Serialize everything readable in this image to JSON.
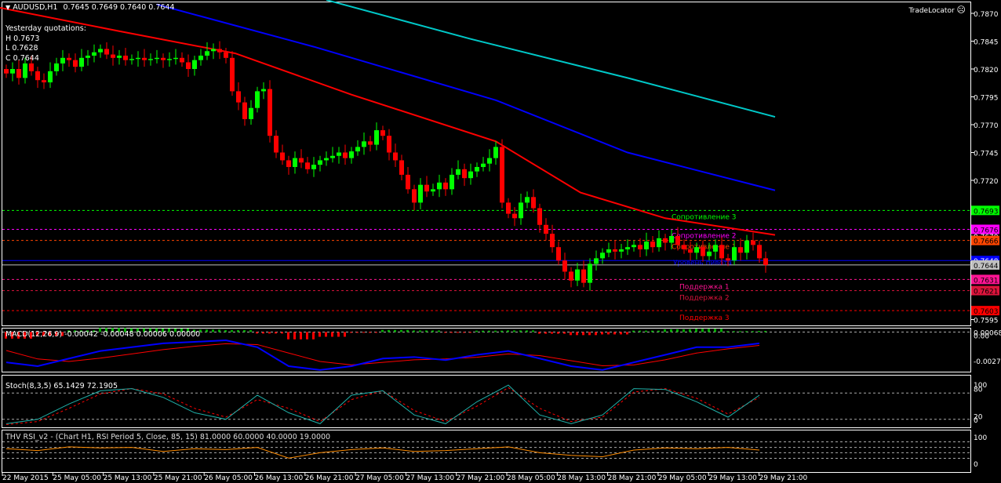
{
  "header": {
    "symbol": "AUDUSD,H1",
    "ohlc": "0.7645 0.7649 0.7640 0.7644"
  },
  "yesterday": {
    "title": "Yesterday quotations:",
    "h": "H 0.7673",
    "l": "L 0.7628",
    "c": "C 0.7644"
  },
  "tradelocator": "TradeLocator",
  "colors": {
    "bull": "#00ff00",
    "bear": "#ff0000",
    "axis": "#ffffff",
    "ma_fast": "#ff0000",
    "ma_mid": "#0000ff",
    "ma_slow": "#00c8c8"
  },
  "chart_data": {
    "type": "candlestick",
    "title": "AUDUSD,H1",
    "ylim": [
      0.759,
      0.7882
    ],
    "price_ticks": [
      "0.7870",
      "0.7845",
      "0.7820",
      "0.7795",
      "0.7770",
      "0.7745",
      "0.7720",
      "0.7670",
      "0.7595"
    ],
    "price_tick_values": [
      0.787,
      0.7845,
      0.782,
      0.7795,
      0.777,
      0.7745,
      0.772,
      0.767,
      0.7595
    ],
    "closes": [
      0.7816,
      0.782,
      0.7812,
      0.7825,
      0.7818,
      0.781,
      0.7808,
      0.7818,
      0.7825,
      0.783,
      0.7828,
      0.7822,
      0.783,
      0.7832,
      0.7835,
      0.7838,
      0.7833,
      0.783,
      0.7832,
      0.7828,
      0.7829,
      0.783,
      0.7828,
      0.7829,
      0.783,
      0.7828,
      0.7829,
      0.783,
      0.7826,
      0.782,
      0.7828,
      0.7832,
      0.7836,
      0.7838,
      0.7835,
      0.783,
      0.78,
      0.779,
      0.7775,
      0.7785,
      0.78,
      0.7802,
      0.776,
      0.7745,
      0.7738,
      0.7732,
      0.774,
      0.7736,
      0.773,
      0.7734,
      0.7738,
      0.774,
      0.7742,
      0.7745,
      0.774,
      0.7746,
      0.775,
      0.7755,
      0.7752,
      0.7765,
      0.776,
      0.7745,
      0.7738,
      0.7725,
      0.7712,
      0.77,
      0.7716,
      0.771,
      0.7712,
      0.7718,
      0.7712,
      0.7725,
      0.773,
      0.7722,
      0.7728,
      0.7732,
      0.7735,
      0.774,
      0.775,
      0.77,
      0.769,
      0.7686,
      0.77,
      0.7705,
      0.7695,
      0.768,
      0.7672,
      0.766,
      0.7648,
      0.7638,
      0.763,
      0.764,
      0.7628,
      0.7645,
      0.765,
      0.7655,
      0.7658,
      0.7656,
      0.7658,
      0.766,
      0.7662,
      0.7658,
      0.7665,
      0.766,
      0.7668,
      0.7664,
      0.767,
      0.7662,
      0.7658,
      0.7655,
      0.766,
      0.7652,
      0.7656,
      0.7662,
      0.765,
      0.7648,
      0.766,
      0.7655,
      0.7666,
      0.7662,
      0.765,
      0.7644
    ],
    "moving_averages": [
      {
        "name": "ma_slow",
        "color": "#00c8c8",
        "points": [
          [
            51,
            0.7882
          ],
          [
            74,
            0.7847
          ],
          [
            99,
            0.7812
          ],
          [
            122.5,
            0.7777
          ]
        ]
      },
      {
        "name": "ma_mid",
        "color": "#0000ff",
        "points": [
          [
            24,
            0.7878
          ],
          [
            49,
            0.784
          ],
          [
            78,
            0.7792
          ],
          [
            99,
            0.7745
          ],
          [
            122.5,
            0.7711
          ]
        ]
      },
      {
        "name": "ma_fast",
        "color": "#ff0000",
        "points": [
          [
            -1,
            0.7875
          ],
          [
            18,
            0.7854
          ],
          [
            36.5,
            0.7834
          ],
          [
            55,
            0.7797
          ],
          [
            78,
            0.7755
          ],
          [
            91.5,
            0.7709
          ],
          [
            105,
            0.7686
          ],
          [
            122.5,
            0.7671
          ]
        ]
      }
    ],
    "levels": [
      {
        "label": "Сопротивление 3",
        "value": 0.7693,
        "tag": "0.7693",
        "color": "#00ff00",
        "dash": true
      },
      {
        "label": "Сопротивление 2",
        "value": 0.7676,
        "tag": "0.7676",
        "color": "#ff00ff",
        "dash": true
      },
      {
        "label": "Сопротивление 1",
        "value": 0.7666,
        "tag": "0.7666",
        "color": "#ff4500",
        "dash": true
      },
      {
        "label": "Уровень пивота",
        "value": 0.7648,
        "tag": "0.7648",
        "color": "#0000ff",
        "dash": false
      },
      {
        "label": "",
        "value": 0.7644,
        "tag": "0.7644",
        "color": "#c0c0c0",
        "dash": false
      },
      {
        "label": "Поддержка 1",
        "value": 0.7631,
        "tag": "0.7631",
        "color": "#ff1493",
        "dash": true
      },
      {
        "label": "Поддержка 2",
        "value": 0.7621,
        "tag": "0.7621",
        "color": "#dc143c",
        "dash": true
      },
      {
        "label": "Поддержка 3",
        "value": 0.7603,
        "tag": "0.7603",
        "color": "#ff0000",
        "dash": true
      }
    ],
    "time_labels": [
      "22 May 2015",
      "25 May 05:00",
      "25 May 13:00",
      "25 May 21:00",
      "26 May 05:00",
      "26 May 13:00",
      "26 May 21:00",
      "27 May 05:00",
      "27 May 13:00",
      "27 May 21:00",
      "28 May 05:00",
      "28 May 13:00",
      "28 May 21:00",
      "29 May 05:00",
      "29 May 13:00",
      "29 May 21:00"
    ],
    "macd": {
      "label": "MACD(12,26,9) -0.00042 -0.00048 0.00006 0.00000",
      "ticks": [
        "0.00068",
        "0.00",
        "-0.00272"
      ],
      "ylim": [
        -0.004,
        0.001
      ],
      "sample_step": 5,
      "main": [
        -0.0029,
        -0.00335,
        -0.00245,
        -0.00156,
        -0.00111,
        -0.00066,
        -0.00048,
        -0.0003,
        -0.00111,
        -0.00335,
        -0.0038,
        -0.00335,
        -0.00245,
        -0.00227,
        -0.00263,
        -0.00201,
        -0.00156,
        -0.00245,
        -0.00335,
        -0.0038,
        -0.0029,
        -0.00201,
        -0.00111,
        -0.00111,
        -0.00066
      ],
      "signal": [
        -0.0015,
        -0.0025,
        -0.0028,
        -0.0024,
        -0.0019,
        -0.0014,
        -0.001,
        -0.0007,
        -0.0008,
        -0.0018,
        -0.0028,
        -0.0032,
        -0.0029,
        -0.0026,
        -0.0025,
        -0.0023,
        -0.0019,
        -0.0021,
        -0.0027,
        -0.0033,
        -0.0032,
        -0.0026,
        -0.0018,
        -0.0013,
        -0.0009
      ]
    },
    "stoch": {
      "label": "Stoch(8,3,5) 65.1429 72.1905",
      "ticks": [
        "100",
        "80",
        "20",
        "0"
      ],
      "sample_step": 5,
      "main": [
        10,
        20,
        55,
        85,
        90,
        70,
        35,
        20,
        75,
        35,
        10,
        75,
        85,
        30,
        10,
        60,
        98,
        30,
        10,
        30,
        90,
        88,
        60,
        25,
        75
      ],
      "signal": [
        8,
        15,
        45,
        78,
        90,
        78,
        45,
        25,
        65,
        45,
        15,
        65,
        85,
        40,
        15,
        50,
        92,
        45,
        15,
        25,
        82,
        90,
        68,
        32,
        70
      ]
    },
    "rsi": {
      "label": "THV RSI_v2 - (Chart H1,  RSI Period 5,  Close,  85,  15)  81.0000 60.0000 40.0000 19.0000",
      "ticks": [
        "100",
        "0"
      ],
      "sample_step": 5,
      "values": [
        55,
        48,
        62,
        58,
        60,
        45,
        55,
        52,
        60,
        20,
        40,
        52,
        58,
        45,
        48,
        55,
        62,
        40,
        30,
        25,
        50,
        58,
        55,
        60,
        50
      ]
    }
  }
}
